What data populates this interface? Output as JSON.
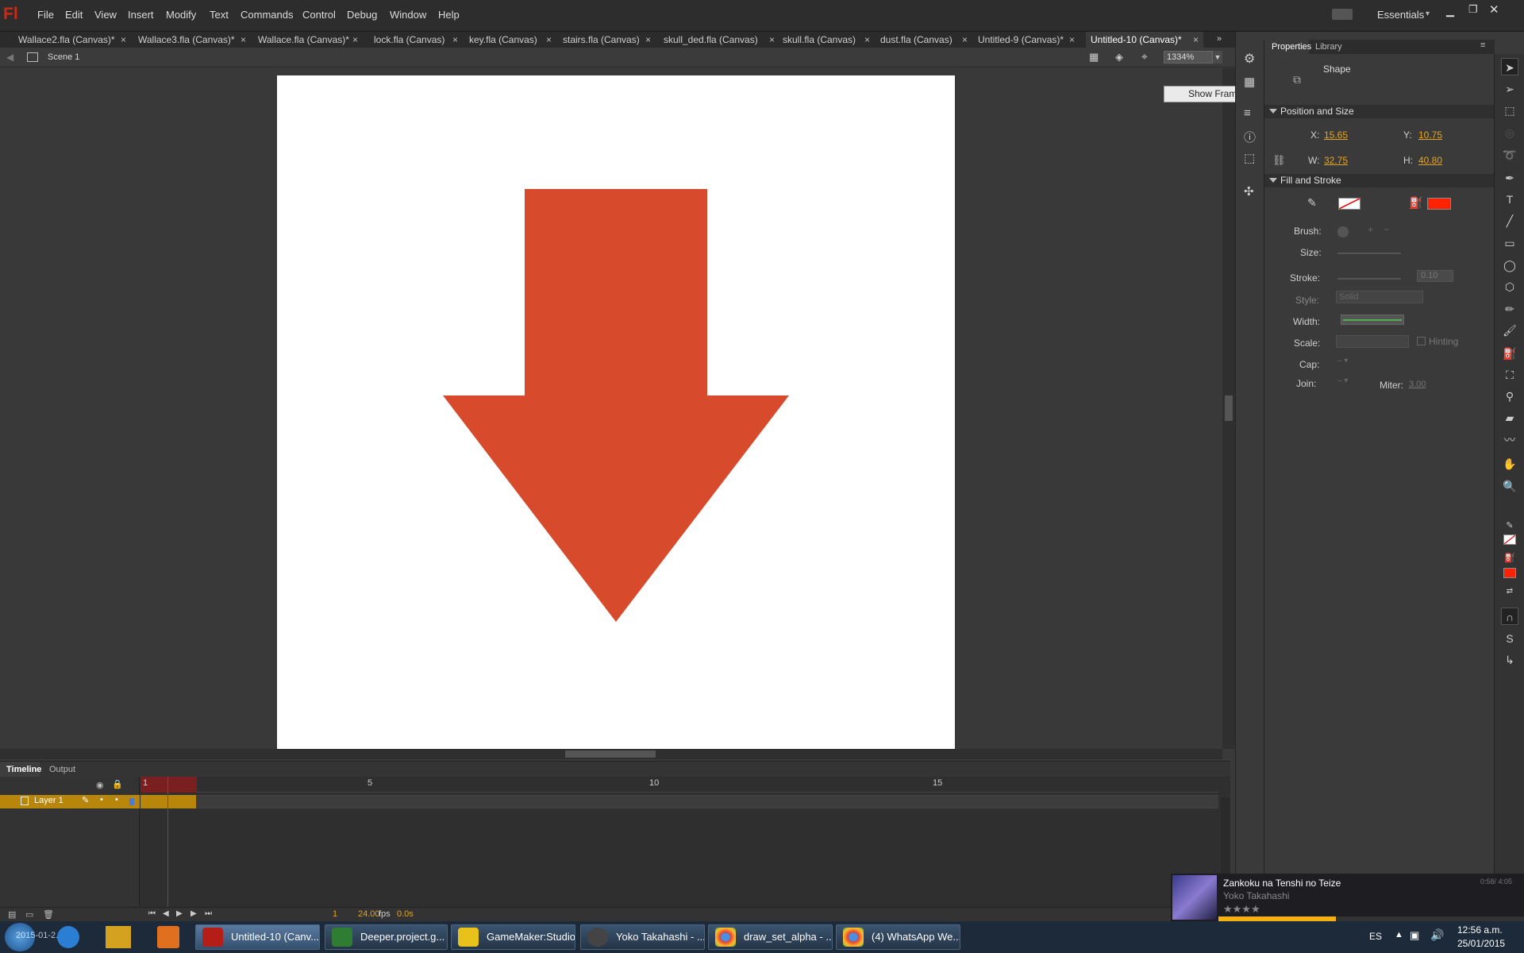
{
  "app": {
    "logo": "Fl",
    "workspace": "Essentials"
  },
  "menu": [
    "File",
    "Edit",
    "View",
    "Insert",
    "Modify",
    "Text",
    "Commands",
    "Control",
    "Debug",
    "Window",
    "Help"
  ],
  "tabs": [
    {
      "label": "Wallace2.fla (Canvas)*"
    },
    {
      "label": "Wallace3.fla (Canvas)*"
    },
    {
      "label": "Wallace.fla (Canvas)*"
    },
    {
      "label": "lock.fla (Canvas)"
    },
    {
      "label": "key.fla (Canvas)"
    },
    {
      "label": "stairs.fla (Canvas)"
    },
    {
      "label": "skull_ded.fla (Canvas)"
    },
    {
      "label": "skull.fla (Canvas)"
    },
    {
      "label": "dust.fla (Canvas)"
    },
    {
      "label": "Untitled-9 (Canvas)*"
    },
    {
      "label": "Untitled-10 (Canvas)*",
      "active": true
    }
  ],
  "tab_close": "×",
  "edit_bar": {
    "scene": "Scene 1",
    "zoom": "1334%"
  },
  "stage": {
    "arrow_color": "#d84a2c",
    "bg": "#ffffff"
  },
  "tooltip": "Show Frame",
  "panel_tabs": {
    "properties": "Properties",
    "library": "Library"
  },
  "properties": {
    "object_type": "Shape",
    "position_size": {
      "title": "Position and Size",
      "x_label": "X:",
      "x": "15.65",
      "y_label": "Y:",
      "y": "10.75",
      "w_label": "W:",
      "w": "32.75",
      "h_label": "H:",
      "h": "40.80"
    },
    "fill_stroke": {
      "title": "Fill and Stroke",
      "fill_color": "#ff2200",
      "brush_label": "Brush:",
      "size_label": "Size:",
      "stroke_label": "Stroke:",
      "stroke_value": "0.10",
      "style_label": "Style:",
      "style_value": "Solid",
      "width_label": "Width:",
      "scale_label": "Scale:",
      "hinting_label": "Hinting",
      "cap_label": "Cap:",
      "join_label": "Join:",
      "miter_label": "Miter:",
      "miter_value": "3.00"
    }
  },
  "timeline": {
    "tab": "Timeline",
    "output_tab": "Output",
    "layer": "Layer 1",
    "frame_numbers": [
      "1",
      "5",
      "10",
      "15"
    ],
    "current_frame": "1",
    "fps": "24.00",
    "fps_unit": "fps",
    "time": "0.0s"
  },
  "player": {
    "title": "Zankoku na Tenshi no Teize",
    "artist": "Yoko Takahashi",
    "time": "0:58/ 4:05",
    "rating": "★★★★"
  },
  "taskbar": {
    "items": [
      {
        "label": "Untitled-10 (Canv...",
        "icon_color": "#b41e16"
      },
      {
        "label": "Deeper.project.g...",
        "icon_color": "#2e7d32"
      },
      {
        "label": "GameMaker:Studio",
        "icon_color": "#e8c21a"
      },
      {
        "label": "Yoko Takahashi - ...",
        "icon_color": "#444"
      },
      {
        "label": "draw_set_alpha - ...",
        "icon_color": "#d33"
      },
      {
        "label": "(4) WhatsApp We...",
        "icon_color": "#d33"
      }
    ],
    "pinned_text": "2015-01-2...",
    "lang": "ES",
    "clock_time": "12:56 a.m.",
    "clock_date": "25/01/2015"
  }
}
